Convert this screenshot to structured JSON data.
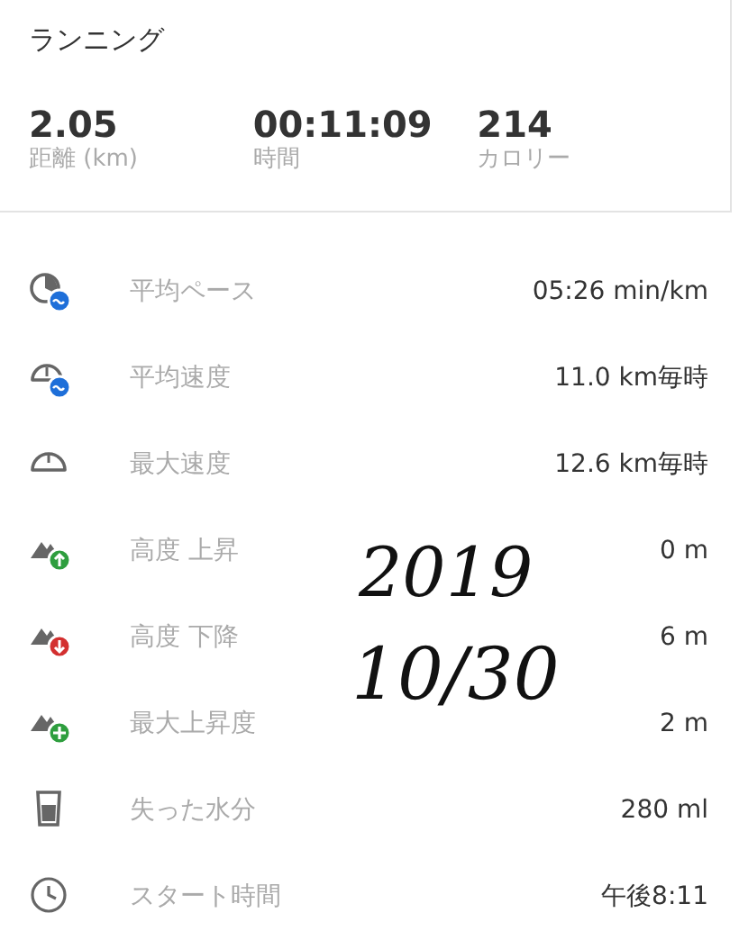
{
  "activity": {
    "title": "ランニング"
  },
  "summary": [
    {
      "value": "2.05",
      "label": "距離 (km)"
    },
    {
      "value": "00:11:09",
      "label": "時間"
    },
    {
      "value": "214",
      "label": "カロリー"
    }
  ],
  "details": [
    {
      "kind": "pace",
      "label": "平均ペース",
      "value": "05:26 min/km"
    },
    {
      "kind": "avg-speed",
      "label": "平均速度",
      "value": "11.0 km毎時"
    },
    {
      "kind": "max-speed",
      "label": "最大速度",
      "value": "12.6 km毎時"
    },
    {
      "kind": "ascent",
      "label": "高度 上昇",
      "value": "0 m"
    },
    {
      "kind": "descent",
      "label": "高度 下降",
      "value": "6 m"
    },
    {
      "kind": "max-elevation",
      "label": "最大上昇度",
      "value": "2 m"
    },
    {
      "kind": "water",
      "label": "失った水分",
      "value": "280 ml"
    },
    {
      "kind": "clock",
      "label": "スタート時間",
      "value": "午後8:11"
    }
  ],
  "handwritten_note": [
    "2019",
    "10/30"
  ]
}
